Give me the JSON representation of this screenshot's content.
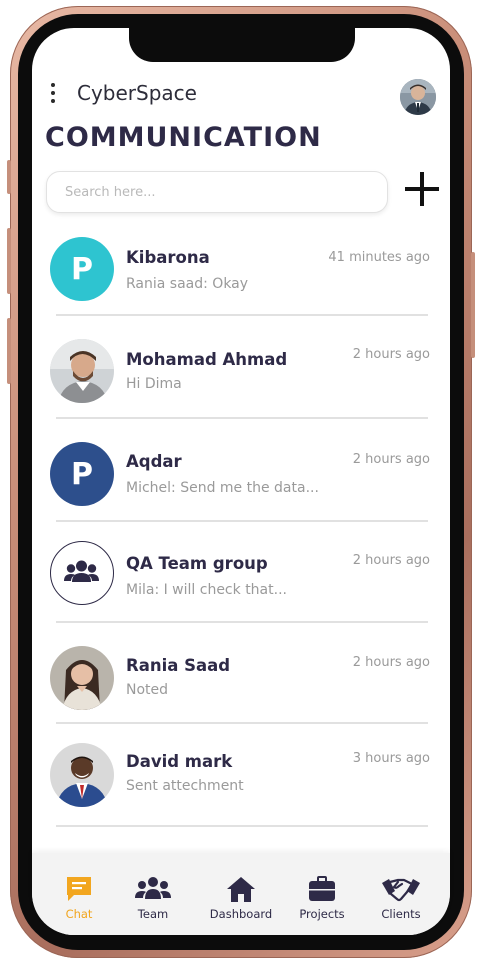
{
  "app": {
    "title": "CyberSpace"
  },
  "header": {
    "title": "COMMUNICATION"
  },
  "search": {
    "placeholder": "Search here...",
    "value": ""
  },
  "conversations": [
    {
      "name": "Kibarona",
      "message": "Rania saad: Okay",
      "time": "41 minutes ago",
      "avatar": "letter",
      "letter": "P",
      "color": "#2ec4d0"
    },
    {
      "name": "Mohamad Ahmad",
      "message": "Hi Dima",
      "time": "2 hours ago",
      "avatar": "photo"
    },
    {
      "name": "Aqdar",
      "message": "Michel: Send me the data...",
      "time": "2 hours ago",
      "avatar": "letter",
      "letter": "P",
      "color": "#2d4f8c"
    },
    {
      "name": "QA Team group",
      "message": "Mila: I will check that...",
      "time": "2 hours ago",
      "avatar": "group-icon"
    },
    {
      "name": "Rania Saad",
      "message": "Noted",
      "time": "2 hours ago",
      "avatar": "photo"
    },
    {
      "name": "David mark",
      "message": "Sent attechment",
      "time": "3 hours ago",
      "avatar": "photo"
    }
  ],
  "tabs": [
    {
      "label": "Chat",
      "icon": "chat-icon",
      "active": true
    },
    {
      "label": "Team",
      "icon": "team-icon",
      "active": false
    },
    {
      "label": "Dashboard",
      "icon": "home-icon",
      "active": false
    },
    {
      "label": "Projects",
      "icon": "briefcase-icon",
      "active": false
    },
    {
      "label": "Clients",
      "icon": "handshake-icon",
      "active": false
    }
  ],
  "colors": {
    "primary": "#2e2a47",
    "accent": "#f2a61f",
    "muted": "#9a9a9a"
  }
}
